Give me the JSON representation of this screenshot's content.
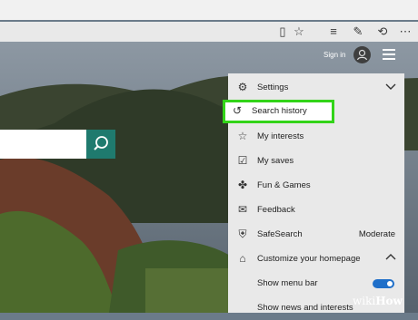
{
  "menu": {
    "items": [
      {
        "label": "Settings",
        "icon": "gear-icon"
      },
      {
        "label": "Search history",
        "icon": "history-icon"
      },
      {
        "label": "My interests",
        "icon": "star-icon"
      },
      {
        "label": "My saves",
        "icon": "saves-icon"
      },
      {
        "label": "Fun & Games",
        "icon": "puzzle-icon"
      },
      {
        "label": "Feedback",
        "icon": "feedback-icon"
      },
      {
        "label": "SafeSearch",
        "icon": "shield-icon",
        "value": "Moderate"
      },
      {
        "label": "Customize your homepage",
        "icon": "home-icon"
      },
      {
        "label": "Show menu bar"
      },
      {
        "label": "Show news and interests"
      }
    ]
  },
  "header": {
    "signin": "Sign in"
  },
  "watermark": {
    "prefix": "wiki",
    "suffix": "How"
  },
  "colors": {
    "accent": "#1f7a6e",
    "highlight": "#32d418",
    "toggle": "#1f6fc9"
  }
}
